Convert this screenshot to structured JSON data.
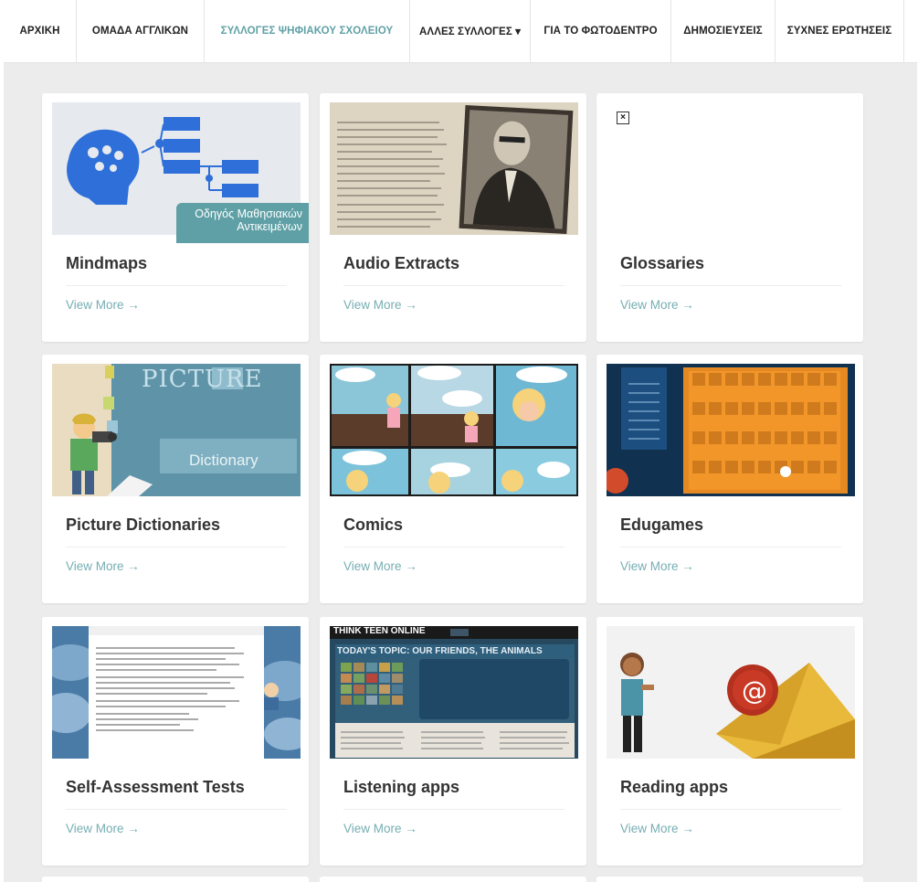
{
  "nav": {
    "items": [
      {
        "label": "ΑΡΧΙΚΗ"
      },
      {
        "label": "ΟΜΑΔΑ ΑΓΓΛΙΚΩΝ"
      },
      {
        "label": "ΣΥΛΛΟΓΕΣ ΨΗΦΙΑΚΟΥ ΣΧΟΛΕΙΟΥ"
      },
      {
        "label": "ΑΛΛΕΣ ΣΥΛΛΟΓΕΣ ▾"
      },
      {
        "label": "ΓΙΑ ΤΟ ΦΩΤΟΔΕΝΤΡΟ"
      },
      {
        "label": "ΔΗΜΟΣΙΕΥΣΕΙΣ"
      },
      {
        "label": "ΣΥΧΝΕΣ ΕΡΩΤΗΣΕΙΣ"
      }
    ],
    "active_color": "#5fa0a6"
  },
  "cards": [
    {
      "title": "Mindmaps",
      "link": "View More →",
      "overlay": "Οδηγός Μαθησιακών Αντικειμένων"
    },
    {
      "title": "Audio Extracts",
      "link": "View More →"
    },
    {
      "title": "Glossaries",
      "link": "View More →"
    },
    {
      "title": "Picture Dictionaries",
      "link": "View More →",
      "thumb_word": "PICTURE",
      "thumb_label": "Dictionary"
    },
    {
      "title": "Comics",
      "link": "View More →"
    },
    {
      "title": "Edugames",
      "link": "View More →"
    },
    {
      "title": "Self-Assessment Tests",
      "link": "View More →"
    },
    {
      "title": "Listening apps",
      "link": "View More →",
      "thumb_header": "THINK TEEN ONLINE",
      "thumb_topic": "TODAY'S TOPIC: OUR FRIENDS, THE ANIMALS"
    },
    {
      "title": "Reading apps",
      "link": "View More →"
    }
  ],
  "colors": {
    "accent": "#76aeb3",
    "background": "#ececec"
  }
}
